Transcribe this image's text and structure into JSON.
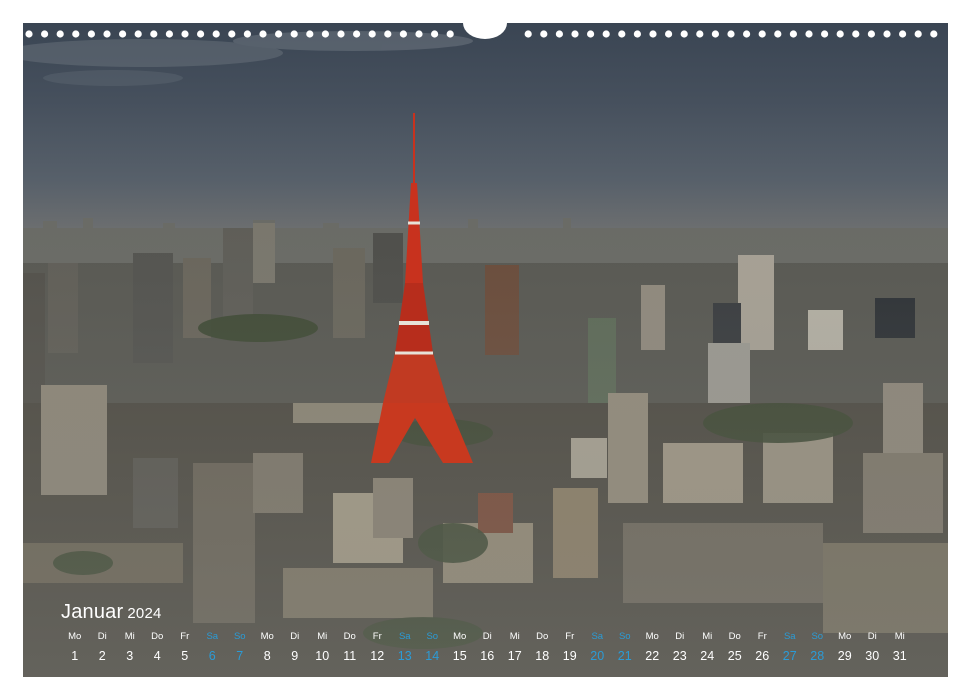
{
  "calendar": {
    "month": "Januar",
    "year": "2024",
    "weekend_color": "#2b9bd6",
    "days": [
      {
        "name": "Mo",
        "num": "1",
        "weekend": false
      },
      {
        "name": "Di",
        "num": "2",
        "weekend": false
      },
      {
        "name": "Mi",
        "num": "3",
        "weekend": false
      },
      {
        "name": "Do",
        "num": "4",
        "weekend": false
      },
      {
        "name": "Fr",
        "num": "5",
        "weekend": false
      },
      {
        "name": "Sa",
        "num": "6",
        "weekend": true
      },
      {
        "name": "So",
        "num": "7",
        "weekend": true
      },
      {
        "name": "Mo",
        "num": "8",
        "weekend": false
      },
      {
        "name": "Di",
        "num": "9",
        "weekend": false
      },
      {
        "name": "Mi",
        "num": "10",
        "weekend": false
      },
      {
        "name": "Do",
        "num": "11",
        "weekend": false
      },
      {
        "name": "Fr",
        "num": "12",
        "weekend": false
      },
      {
        "name": "Sa",
        "num": "13",
        "weekend": true
      },
      {
        "name": "So",
        "num": "14",
        "weekend": true
      },
      {
        "name": "Mo",
        "num": "15",
        "weekend": false
      },
      {
        "name": "Di",
        "num": "16",
        "weekend": false
      },
      {
        "name": "Mi",
        "num": "17",
        "weekend": false
      },
      {
        "name": "Do",
        "num": "18",
        "weekend": false
      },
      {
        "name": "Fr",
        "num": "19",
        "weekend": false
      },
      {
        "name": "Sa",
        "num": "20",
        "weekend": true
      },
      {
        "name": "So",
        "num": "21",
        "weekend": true
      },
      {
        "name": "Mo",
        "num": "22",
        "weekend": false
      },
      {
        "name": "Di",
        "num": "23",
        "weekend": false
      },
      {
        "name": "Mi",
        "num": "24",
        "weekend": false
      },
      {
        "name": "Do",
        "num": "25",
        "weekend": false
      },
      {
        "name": "Fr",
        "num": "26",
        "weekend": false
      },
      {
        "name": "Sa",
        "num": "27",
        "weekend": true
      },
      {
        "name": "So",
        "num": "28",
        "weekend": true
      },
      {
        "name": "Mo",
        "num": "29",
        "weekend": false
      },
      {
        "name": "Di",
        "num": "30",
        "weekend": false
      },
      {
        "name": "Mi",
        "num": "31",
        "weekend": false
      }
    ]
  },
  "photo": {
    "subject": "tokyo-tower-skyline",
    "tower_color": "#c8321e"
  }
}
